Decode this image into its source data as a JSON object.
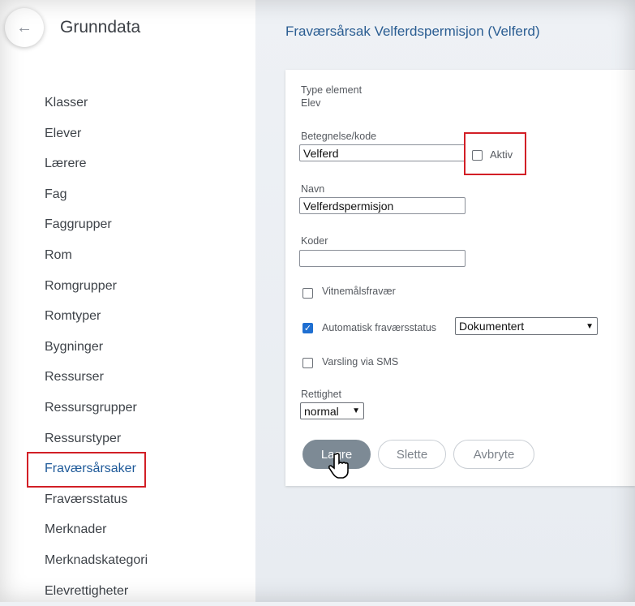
{
  "sidebar": {
    "back_icon": "arrow-left-icon",
    "title": "Grunndata",
    "items": [
      {
        "label": "Klasser"
      },
      {
        "label": "Elever"
      },
      {
        "label": "Lærere"
      },
      {
        "label": "Fag"
      },
      {
        "label": "Faggrupper"
      },
      {
        "label": "Rom"
      },
      {
        "label": "Romgrupper"
      },
      {
        "label": "Romtyper"
      },
      {
        "label": "Bygninger"
      },
      {
        "label": "Ressurser"
      },
      {
        "label": "Ressursgrupper"
      },
      {
        "label": "Ressurstyper"
      },
      {
        "label": "Fraværsårsaker",
        "active": true
      },
      {
        "label": "Fraværsstatus"
      },
      {
        "label": "Merknader"
      },
      {
        "label": "Merknadskategori"
      },
      {
        "label": "Elevrettigheter"
      }
    ]
  },
  "page": {
    "title": "Fraværsårsak Velferdspermisjon (Velferd)"
  },
  "form": {
    "type_element_label": "Type element",
    "type_element_value": "Elev",
    "code_label": "Betegnelse/kode",
    "code_value": "Velferd",
    "aktiv_label": "Aktiv",
    "aktiv_checked": false,
    "name_label": "Navn",
    "name_value": "Velferdspermisjon",
    "codes_label": "Koder",
    "codes_value": "",
    "vitnemal_label": "Vitnemålsfravær",
    "vitnemal_checked": false,
    "auto_status_label": "Automatisk fraværsstatus",
    "auto_status_checked": true,
    "auto_status_value": "Dokumentert",
    "sms_label": "Varsling via SMS",
    "sms_checked": false,
    "rettighet_label": "Rettighet",
    "rettighet_value": "normal"
  },
  "buttons": {
    "save": "Lagre",
    "delete": "Slette",
    "cancel": "Avbryte"
  },
  "colors": {
    "accent": "#1f5a99",
    "highlight": "#d21f26",
    "checkbox_checked": "#1f6fd1"
  }
}
